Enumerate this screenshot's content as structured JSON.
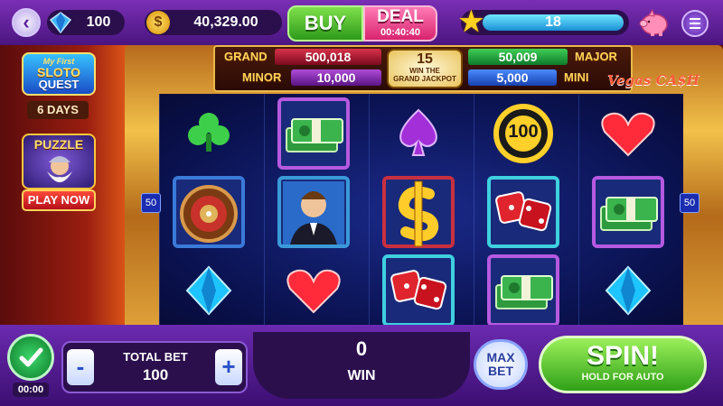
{
  "header": {
    "gems": "100",
    "coins": "40,329.00",
    "buy_label": "BUY",
    "deal_label": "DEAL",
    "deal_timer": "00:40:40",
    "level": "18"
  },
  "jackpots": {
    "grand_label": "GRAND",
    "grand_value": "500,018",
    "major_label": "MAJOR",
    "major_value": "50,009",
    "minor_label": "MINOR",
    "minor_value": "10,000",
    "mini_label": "MINI",
    "mini_value": "5,000",
    "center_count": "15",
    "center_text_1": "WIN THE",
    "center_text_2": "GRAND JACKPOT"
  },
  "logo": {
    "vegas_cash": "Vegas CA$H"
  },
  "promos": {
    "sloto_line1": "My First",
    "sloto_line2": "SLOTO",
    "sloto_line3": "QUEST",
    "sloto_days": "6 DAYS",
    "puzzle_title": "PUZZLE",
    "play_now": "PLAY NOW"
  },
  "paylines": {
    "left": "50",
    "right": "50"
  },
  "reels": [
    [
      "club",
      "roulette",
      "diamond"
    ],
    [
      "money",
      "gentleman",
      "heart"
    ],
    [
      "spade",
      "dollar",
      "dice"
    ],
    [
      "coin100",
      "dice",
      "money"
    ],
    [
      "heart",
      "money",
      "diamond"
    ]
  ],
  "coin_symbol_value": "100",
  "bottom": {
    "auto_timer": "00:00",
    "total_bet_label": "TOTAL BET",
    "total_bet_value": "100",
    "minus": "-",
    "plus": "+",
    "win_value": "0",
    "win_label": "WIN",
    "max_bet_line1": "MAX",
    "max_bet_line2": "BET",
    "spin_label": "SPIN!",
    "spin_sub": "HOLD FOR AUTO"
  },
  "colors": {
    "bar_purple": "#6b2ab0",
    "spin_green": "#2fa018",
    "reel_blue": "#0a1250",
    "frame_gold": "#f2c14a"
  }
}
